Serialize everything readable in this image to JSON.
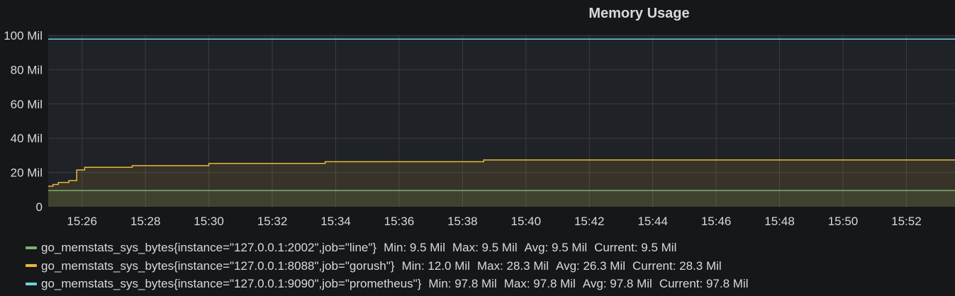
{
  "panel": {
    "title": "Memory Usage"
  },
  "chart_data": {
    "type": "line",
    "title": "Memory Usage",
    "xlabel": "",
    "ylabel": "",
    "y_ticks": [
      "0",
      "20 Mil",
      "40 Mil",
      "60 Mil",
      "80 Mil",
      "100 Mil"
    ],
    "ylim": [
      0,
      100000000
    ],
    "x_ticks": [
      "15:26",
      "15:28",
      "15:30",
      "15:32",
      "15:34",
      "15:36",
      "15:38",
      "15:40",
      "15:42",
      "15:44",
      "15:46",
      "15:48",
      "15:50",
      "15:52"
    ],
    "xlim": [
      "15:24:56",
      "15:53:32"
    ],
    "grid": true,
    "legend_position": "bottom",
    "series": [
      {
        "name": "go_memstats_sys_bytes{instance=\"127.0.0.1:2002\",job=\"line\"}",
        "color": "#7eb26d",
        "fill": true,
        "points": [
          [
            "15:24:56",
            9500000
          ],
          [
            "15:53:32",
            9500000
          ]
        ],
        "stats": {
          "min": "Min: 9.5 Mil",
          "max": "Max: 9.5 Mil",
          "avg": "Avg: 9.5 Mil",
          "current": "Current: 9.5 Mil"
        }
      },
      {
        "name": "go_memstats_sys_bytes{instance=\"127.0.0.1:8088\",job=\"gorush\"}",
        "color": "#eab839",
        "fill": true,
        "points": [
          [
            "15:24:56",
            12000000
          ],
          [
            "15:25:05",
            12000000
          ],
          [
            "15:25:05",
            13000000
          ],
          [
            "15:25:15",
            13000000
          ],
          [
            "15:25:15",
            14200000
          ],
          [
            "15:25:35",
            14200000
          ],
          [
            "15:25:35",
            15300000
          ],
          [
            "15:25:50",
            15300000
          ],
          [
            "15:25:50",
            21500000
          ],
          [
            "15:26:05",
            21500000
          ],
          [
            "15:26:05",
            23000000
          ],
          [
            "15:27:35",
            23000000
          ],
          [
            "15:27:35",
            24000000
          ],
          [
            "15:30:00",
            24000000
          ],
          [
            "15:30:00",
            25300000
          ],
          [
            "15:33:40",
            25300000
          ],
          [
            "15:33:40",
            26300000
          ],
          [
            "15:38:40",
            26300000
          ],
          [
            "15:38:40",
            27300000
          ],
          [
            "15:53:32",
            27300000
          ]
        ],
        "stats": {
          "min": "Min: 12.0 Mil",
          "max": "Max: 28.3 Mil",
          "avg": "Avg: 26.3 Mil",
          "current": "Current: 28.3 Mil"
        }
      },
      {
        "name": "go_memstats_sys_bytes{instance=\"127.0.0.1:9090\",job=\"prometheus\"}",
        "color": "#6ed0e0",
        "fill": false,
        "points": [
          [
            "15:24:56",
            97800000
          ],
          [
            "15:53:32",
            97800000
          ]
        ],
        "stats": {
          "min": "Min: 97.8 Mil",
          "max": "Max: 97.8 Mil",
          "avg": "Avg: 97.8 Mil",
          "current": "Current: 97.8 Mil"
        }
      }
    ]
  }
}
